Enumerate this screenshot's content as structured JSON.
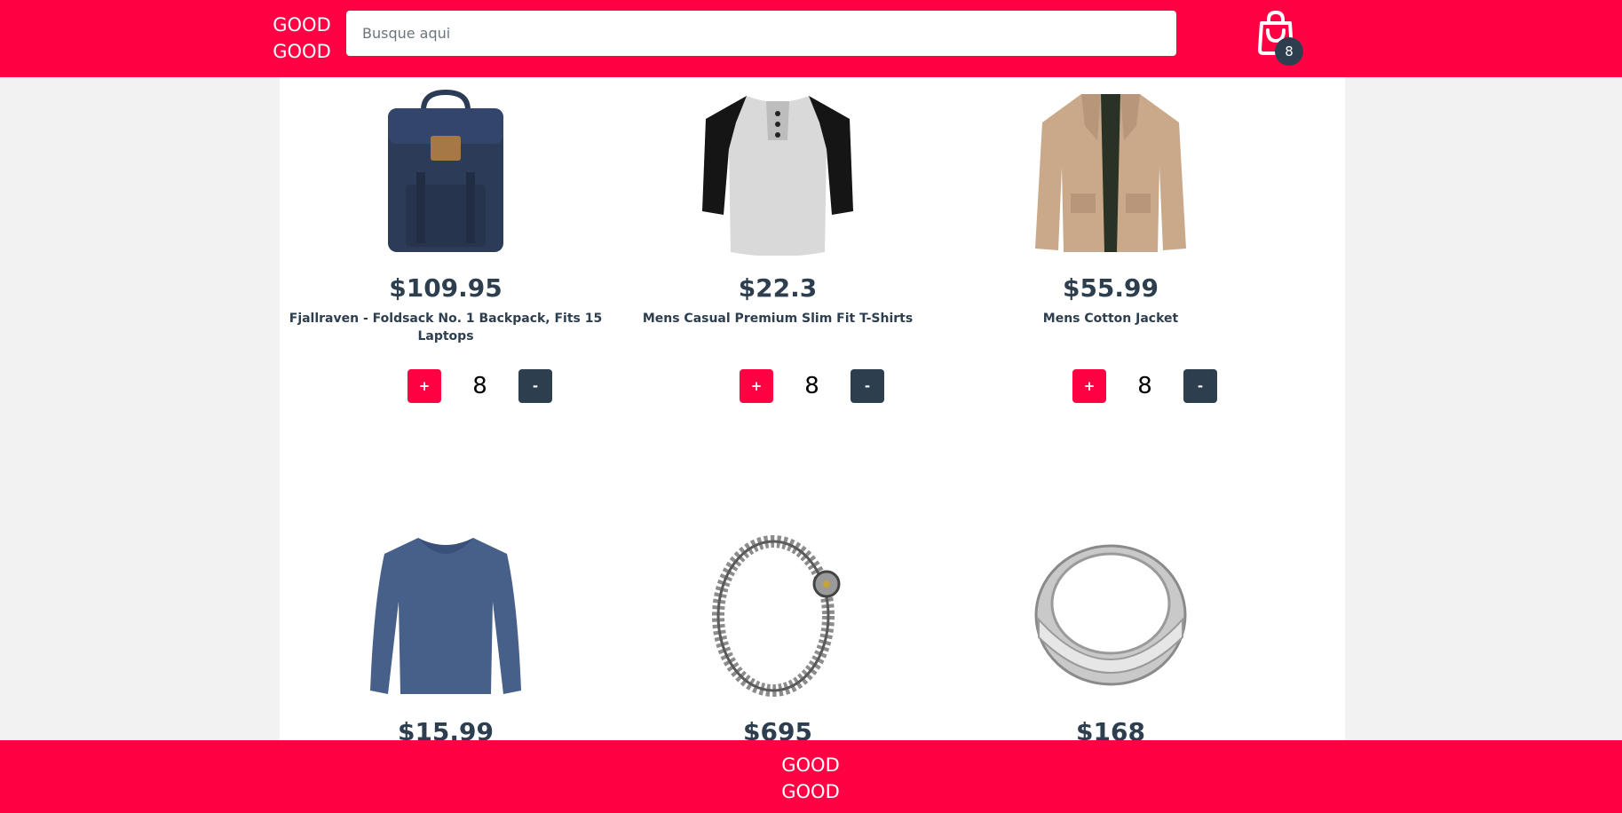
{
  "header": {
    "logo_line1": "GOOD",
    "logo_line2": "GOOD",
    "search_placeholder": "Busque aqui",
    "cart_count": "8",
    "cart_icon": "shopping-bag-icon"
  },
  "colors": {
    "brand": "#ff0244",
    "dark": "#2d3e4f",
    "background": "#f2f2f2",
    "panel": "#ffffff"
  },
  "products": [
    {
      "price": "$109.95",
      "title": "Fjallraven - Foldsack No. 1 Backpack, Fits 15 Laptops",
      "quantity": "8",
      "plus_label": "+",
      "minus_label": "-",
      "image": "backpack-image"
    },
    {
      "price": "$22.3",
      "title": "Mens Casual Premium Slim Fit T-Shirts",
      "quantity": "8",
      "plus_label": "+",
      "minus_label": "-",
      "image": "raglan-tshirt-image"
    },
    {
      "price": "$55.99",
      "title": "Mens Cotton Jacket",
      "quantity": "8",
      "plus_label": "+",
      "minus_label": "-",
      "image": "jacket-image"
    },
    {
      "price": "$15.99",
      "image": "longsleeve-shirt-image"
    },
    {
      "price": "$695",
      "image": "dragon-bracelet-image"
    },
    {
      "price": "$168",
      "image": "silver-ring-image"
    }
  ],
  "footer": {
    "logo_line1": "GOOD",
    "logo_line2": "GOOD"
  }
}
